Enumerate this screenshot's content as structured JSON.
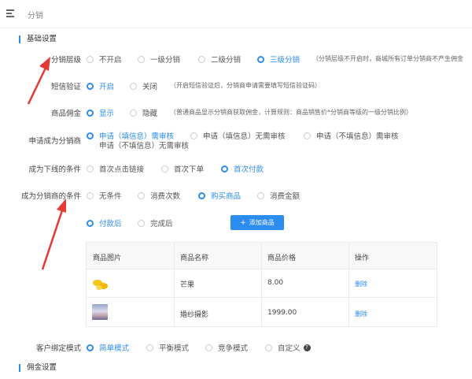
{
  "header": {
    "title": "分销"
  },
  "sections": {
    "basic": "基础设置",
    "commission": "佣金设置"
  },
  "level": {
    "label": "分销层级",
    "options": [
      "不开启",
      "一级分销",
      "二级分销",
      "三级分销"
    ],
    "selected": "三级分销",
    "hint": "（分销层级不开启时，商城所有订单分销商不产生佣金"
  },
  "sms": {
    "label": "短信验证",
    "options": [
      "开启",
      "关闭"
    ],
    "selected": "开启",
    "hint": "（开启短信验证后，分销商申请需要填写短信验证码）"
  },
  "commission": {
    "label": "商品佣金",
    "options": [
      "显示",
      "隐藏"
    ],
    "selected": "显示",
    "hint": "（普通商品显示分销商获取佣金，计算规则：商品销售价*分销商等级的一级分销比例）"
  },
  "apply": {
    "label": "申请成为分销商",
    "options": [
      "申请（填信息）需审核",
      "申请（填信息）无需审核",
      "申请（不填信息）需审核",
      "申请（不填信息）无需审核"
    ],
    "selected": "申请（填信息）需审核"
  },
  "downline": {
    "label": "成为下线的条件",
    "options": [
      "首次点击链接",
      "首次下单",
      "首次付款"
    ],
    "selected": "首次付款"
  },
  "become": {
    "label": "成为分销商的条件",
    "options": [
      "无条件",
      "消费次数",
      "购买商品",
      "消费金额"
    ],
    "selected": "购买商品",
    "timing_options": [
      "付款后",
      "完成后"
    ],
    "timing_selected": "付款后",
    "add_button": "添加商品"
  },
  "table": {
    "headers": [
      "商品图片",
      "商品名称",
      "商品价格",
      "操作"
    ],
    "rows": [
      {
        "name": "芒果",
        "price": "8.00",
        "action": "删除",
        "image_icon": "mango-image"
      },
      {
        "name": "婚纱摄影",
        "price": "1999.00",
        "action": "删除",
        "image_icon": "wedding-photo-image"
      }
    ]
  },
  "binding": {
    "label": "客户绑定模式",
    "options": [
      "简单模式",
      "平衡模式",
      "竞争模式",
      "自定义"
    ],
    "selected": "简单模式",
    "help_icon": "question-icon"
  },
  "colors": {
    "accent": "#2d8cf0",
    "arrow": "#e53935"
  }
}
